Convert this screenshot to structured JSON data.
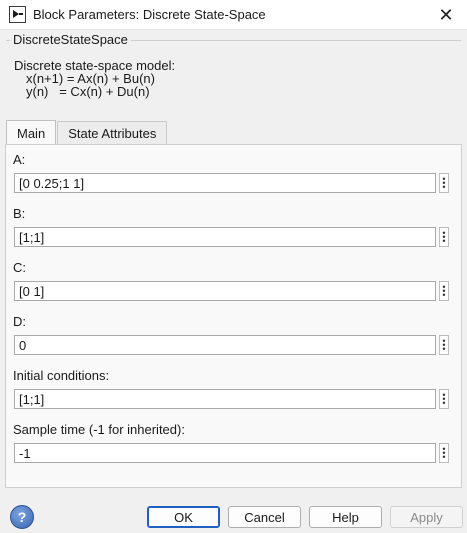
{
  "window": {
    "title": "Block Parameters: Discrete State-Space",
    "close_glyph": "✕"
  },
  "description": {
    "legend": "DiscreteStateSpace",
    "lines": [
      "Discrete state-space model:",
      "x(n+1) = Ax(n) + Bu(n)",
      "y(n)   = Cx(n) + Du(n)"
    ]
  },
  "tabs": [
    {
      "label": "Main",
      "active": true
    },
    {
      "label": "State Attributes",
      "active": false
    }
  ],
  "params": [
    {
      "label": "A:",
      "value": "[0 0.25;1 1]"
    },
    {
      "label": "B:",
      "value": "[1;1]"
    },
    {
      "label": "C:",
      "value": "[0 1]"
    },
    {
      "label": "D:",
      "value": "0"
    },
    {
      "label": "Initial conditions:",
      "value": "[1;1]"
    },
    {
      "label": "Sample time (-1 for inherited):",
      "value": "-1"
    }
  ],
  "buttons": {
    "ok": "OK",
    "cancel": "Cancel",
    "help": "Help",
    "apply": "Apply"
  },
  "help_icon_glyph": "?"
}
